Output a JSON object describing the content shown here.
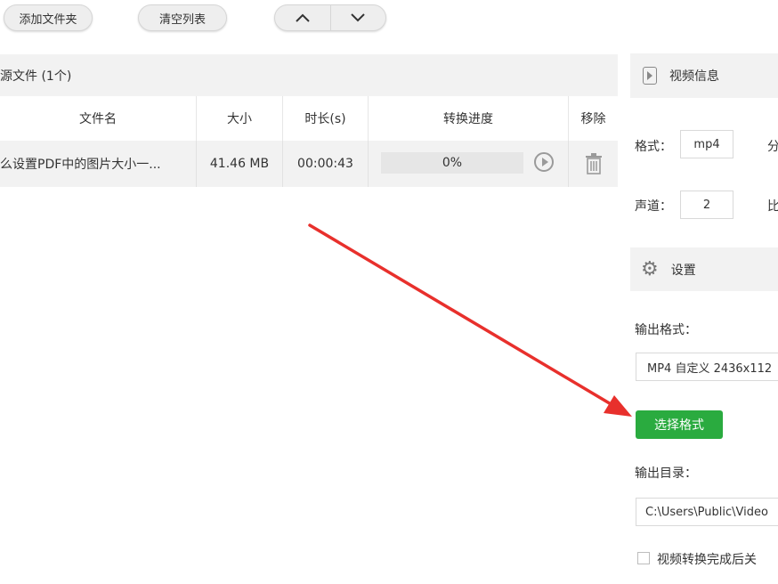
{
  "toolbar": {
    "add_folder": "添加文件夹",
    "clear_list": "清空列表",
    "up": "∧",
    "down": "∨"
  },
  "source": {
    "title": "源文件 (1个)"
  },
  "table": {
    "headers": [
      "文件名",
      "大小",
      "时长(s)",
      "转换进度",
      "移除"
    ],
    "rows": [
      {
        "name": "么设置PDF中的图片大小一...",
        "size": "41.46 MB",
        "duration": "00:00:43",
        "progress": "0%"
      }
    ]
  },
  "video_info": {
    "title": "视频信息",
    "format_label": "格式：",
    "format_value": "mp4",
    "format_extra": "分",
    "channel_label": "声道：",
    "channel_value": "2",
    "channel_extra": "比"
  },
  "settings": {
    "title": "设置",
    "output_format_label": "输出格式：",
    "output_format_value": "MP4 自定义 2436x112",
    "choose_format": "选择格式",
    "output_dir_label": "输出目录：",
    "output_dir_value": "C:\\Users\\Public\\Video",
    "after_convert": "视频转换完成后关"
  },
  "colors": {
    "accent_green": "#2aab3f",
    "arrow_red": "#e8302c",
    "panel_bg": "#f2f2f2"
  }
}
